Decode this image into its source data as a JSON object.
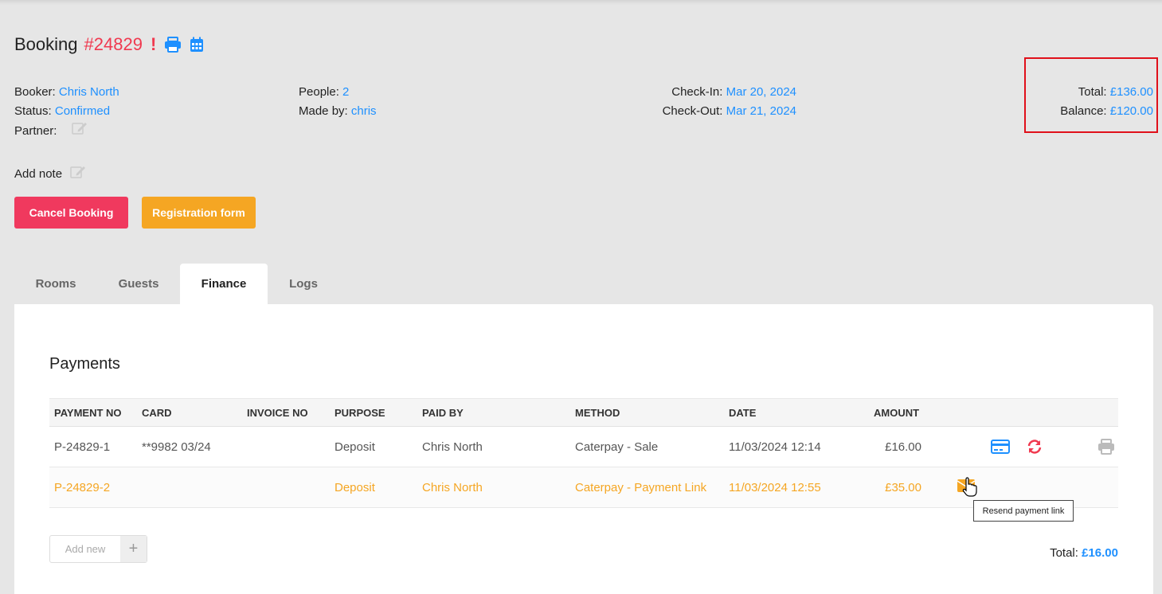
{
  "header": {
    "title": "Booking",
    "booking_id": "#24829",
    "alert": "!",
    "print_icon": "print-icon",
    "calendar_icon": "calendar-icon",
    "accent": "#1e90ff",
    "alert_color": "#f0394f"
  },
  "details": {
    "booker_label": "Booker:",
    "booker": "Chris North",
    "status_label": "Status:",
    "status": "Confirmed",
    "partner_label": "Partner:",
    "people_label": "People:",
    "people": "2",
    "made_by_label": "Made by:",
    "made_by": "chris",
    "checkin_label": "Check-In:",
    "checkin": "Mar 20, 2024",
    "checkout_label": "Check-Out:",
    "checkout": "Mar 21, 2024",
    "total_label": "Total:",
    "total": "£136.00",
    "balance_label": "Balance:",
    "balance": "£120.00"
  },
  "note": {
    "label": "Add note"
  },
  "actions": {
    "cancel_label": "Cancel Booking",
    "cancel_color": "#f0395e",
    "registration_label": "Registration form",
    "registration_color": "#f5a623"
  },
  "tabs": [
    {
      "label": "Rooms"
    },
    {
      "label": "Guests"
    },
    {
      "label": "Finance",
      "active": true
    },
    {
      "label": "Logs"
    }
  ],
  "payments": {
    "title": "Payments",
    "columns": [
      "PAYMENT NO",
      "CARD",
      "INVOICE NO",
      "PURPOSE",
      "PAID BY",
      "METHOD",
      "DATE",
      "AMOUNT"
    ],
    "rows": [
      {
        "payment_no": "P-24829-1",
        "card": "**9982 03/24",
        "invoice_no": "",
        "purpose": "Deposit",
        "paid_by": "Chris North",
        "method": "Caterpay - Sale",
        "date": "11/03/2024 12:14",
        "amount": "£16.00",
        "actions": [
          "credit-card-icon",
          "refund-icon",
          "print-icon"
        ]
      },
      {
        "payment_no": "P-24829-2",
        "card": "",
        "invoice_no": "",
        "purpose": "Deposit",
        "paid_by": "Chris North",
        "method": "Caterpay - Payment Link",
        "date": "11/03/2024 12:55",
        "amount": "£35.00",
        "actions": [
          "envelope-icon"
        ],
        "pending_color": "#f5a623"
      }
    ],
    "tooltip": "Resend payment link",
    "add_new_label": "Add new",
    "add_new_icon": "plus-icon",
    "total_label": "Total:",
    "total": "£16.00"
  }
}
